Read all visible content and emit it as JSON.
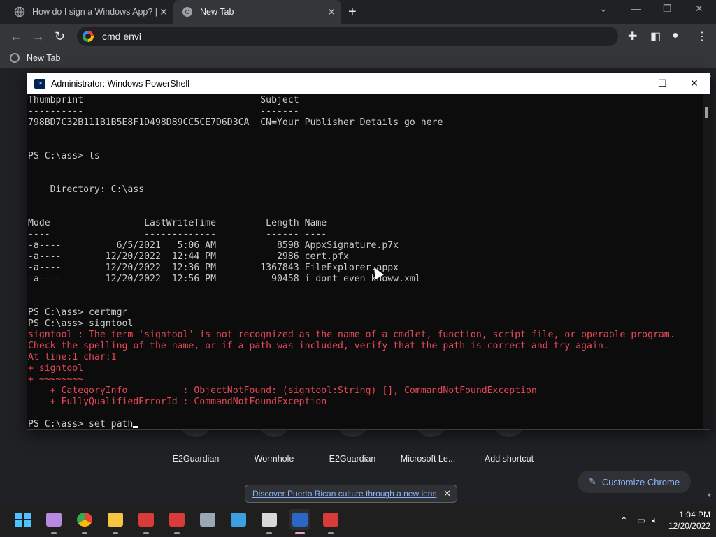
{
  "browser": {
    "tabs": [
      {
        "title": "How do I sign a Windows App? |"
      },
      {
        "title": "New Tab"
      }
    ],
    "omnibox_value": "cmd envi",
    "bookmarks": [
      {
        "label": "New Tab"
      }
    ]
  },
  "ntp": {
    "shortcuts": [
      {
        "label": "E2Guardian"
      },
      {
        "label": "Wormhole"
      },
      {
        "label": "E2Guardian"
      },
      {
        "label": "Microsoft Le..."
      },
      {
        "label": "Add shortcut"
      }
    ],
    "customize_label": "Customize Chrome",
    "discover_text": "Discover Puerto Rican culture through a new lens"
  },
  "powershell": {
    "title": "Administrator: Windows PowerShell",
    "lines": [
      {
        "text": "Thumbprint                                Subject",
        "err": false
      },
      {
        "text": "----------                                -------",
        "err": false
      },
      {
        "text": "798BD7C32B111B1B5E8F1D498D89CC5CE7D6D3CA  CN=Your Publisher Details go here",
        "err": false
      },
      {
        "text": "",
        "err": false
      },
      {
        "text": "",
        "err": false
      },
      {
        "text": "PS C:\\ass> ls",
        "err": false
      },
      {
        "text": "",
        "err": false
      },
      {
        "text": "",
        "err": false
      },
      {
        "text": "    Directory: C:\\ass",
        "err": false
      },
      {
        "text": "",
        "err": false
      },
      {
        "text": "",
        "err": false
      },
      {
        "text": "Mode                 LastWriteTime         Length Name",
        "err": false
      },
      {
        "text": "----                 -------------         ------ ----",
        "err": false
      },
      {
        "text": "-a----          6/5/2021   5:06 AM           8598 AppxSignature.p7x",
        "err": false
      },
      {
        "text": "-a----        12/20/2022  12:44 PM           2986 cert.pfx",
        "err": false
      },
      {
        "text": "-a----        12/20/2022  12:36 PM        1367843 FileExplorer.appx",
        "err": false
      },
      {
        "text": "-a----        12/20/2022  12:56 PM          90458 i dont even knoww.xml",
        "err": false
      },
      {
        "text": "",
        "err": false
      },
      {
        "text": "",
        "err": false
      },
      {
        "text": "PS C:\\ass> certmgr",
        "err": false
      },
      {
        "text": "PS C:\\ass> signtool",
        "err": false
      },
      {
        "text": "signtool : The term 'signtool' is not recognized as the name of a cmdlet, function, script file, or operable program.",
        "err": true
      },
      {
        "text": "Check the spelling of the name, or if a path was included, verify that the path is correct and try again.",
        "err": true
      },
      {
        "text": "At line:1 char:1",
        "err": true
      },
      {
        "text": "+ signtool",
        "err": true
      },
      {
        "text": "+ ~~~~~~~~",
        "err": true
      },
      {
        "text": "    + CategoryInfo          : ObjectNotFound: (signtool:String) [], CommandNotFoundException",
        "err": true
      },
      {
        "text": "    + FullyQualifiedErrorId : CommandNotFoundException",
        "err": true
      },
      {
        "text": "",
        "err": false
      }
    ],
    "prompt": "PS C:\\ass> set path"
  },
  "taskbar": {
    "apps": [
      {
        "name": "start-button",
        "color": "#4cc2ff"
      },
      {
        "name": "notes-app",
        "color": "#b58ae0"
      },
      {
        "name": "chrome-app",
        "color": "#e94235"
      },
      {
        "name": "file-explorer-app",
        "color": "#f5c542"
      },
      {
        "name": "toolbox-app",
        "color": "#d93a3a"
      },
      {
        "name": "toolbox-app-2",
        "color": "#d93a3a"
      },
      {
        "name": "settings-app",
        "color": "#9aa7b4"
      },
      {
        "name": "blue-app",
        "color": "#3aa0e0"
      },
      {
        "name": "certmgr-app",
        "color": "#d8d8d8"
      },
      {
        "name": "powershell-app",
        "color": "#2b66c9"
      },
      {
        "name": "toolbox-app-3",
        "color": "#d93a3a"
      }
    ],
    "time": "1:04 PM",
    "date": "12/20/2022"
  }
}
